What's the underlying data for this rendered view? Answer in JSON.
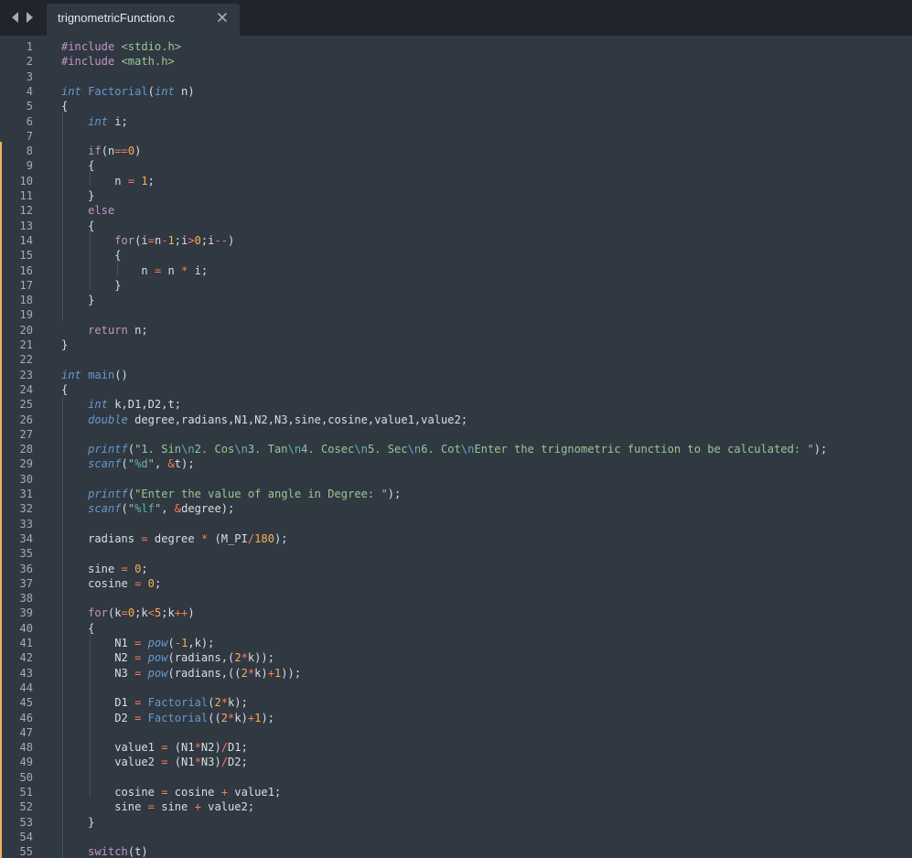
{
  "nav": {
    "back_icon": "chevron-left-icon",
    "forward_icon": "chevron-right-icon"
  },
  "tab": {
    "title": "trignometricFunction.c",
    "close_glyph": "×"
  },
  "colors": {
    "background": "#303841",
    "tabbar": "#1f252b",
    "keyword": "#c594c5",
    "type": "#6699cc",
    "function": "#6699cc",
    "operator": "#f97b58",
    "number": "#f9ae58",
    "string": "#99c794",
    "escape": "#5fb3b3",
    "plain": "#d8dee9",
    "line_number": "#a6acb3"
  },
  "code": {
    "lines": [
      [
        [
          "pp",
          "#include "
        ],
        [
          "ic",
          "<stdio.h>"
        ]
      ],
      [
        [
          "pp",
          "#include "
        ],
        [
          "ic",
          "<math.h>"
        ]
      ],
      [],
      [
        [
          "ty",
          "int"
        ],
        [
          "t",
          " "
        ],
        [
          "fn",
          "Factorial"
        ],
        [
          "t",
          "("
        ],
        [
          "ty",
          "int"
        ],
        [
          "t",
          " n)"
        ]
      ],
      [
        [
          "t",
          "{"
        ]
      ],
      [
        [
          "t",
          "    "
        ],
        [
          "ty",
          "int"
        ],
        [
          "t",
          " i;"
        ]
      ],
      [],
      [
        [
          "t",
          "    "
        ],
        [
          "kw",
          "if"
        ],
        [
          "t",
          "(n"
        ],
        [
          "op",
          "=="
        ],
        [
          "nm",
          "0"
        ],
        [
          "t",
          ")"
        ]
      ],
      [
        [
          "t",
          "    {"
        ]
      ],
      [
        [
          "t",
          "        n "
        ],
        [
          "op",
          "="
        ],
        [
          "t",
          " "
        ],
        [
          "nm",
          "1"
        ],
        [
          "t",
          ";"
        ]
      ],
      [
        [
          "t",
          "    }"
        ]
      ],
      [
        [
          "t",
          "    "
        ],
        [
          "kw",
          "else"
        ]
      ],
      [
        [
          "t",
          "    {"
        ]
      ],
      [
        [
          "t",
          "        "
        ],
        [
          "kw",
          "for"
        ],
        [
          "t",
          "(i"
        ],
        [
          "op",
          "="
        ],
        [
          "t",
          "n"
        ],
        [
          "op",
          "-"
        ],
        [
          "nm",
          "1"
        ],
        [
          "t",
          ";i"
        ],
        [
          "op",
          ">"
        ],
        [
          "nm",
          "0"
        ],
        [
          "t",
          ";i"
        ],
        [
          "op",
          "--"
        ],
        [
          "t",
          ")"
        ]
      ],
      [
        [
          "t",
          "        {"
        ]
      ],
      [
        [
          "t",
          "            n "
        ],
        [
          "op",
          "="
        ],
        [
          "t",
          " n "
        ],
        [
          "op",
          "*"
        ],
        [
          "t",
          " i;"
        ]
      ],
      [
        [
          "t",
          "        }"
        ]
      ],
      [
        [
          "t",
          "    }"
        ]
      ],
      [],
      [
        [
          "t",
          "    "
        ],
        [
          "kw",
          "return"
        ],
        [
          "t",
          " n;"
        ]
      ],
      [
        [
          "t",
          "}"
        ]
      ],
      [],
      [
        [
          "ty",
          "int"
        ],
        [
          "t",
          " "
        ],
        [
          "fn",
          "main"
        ],
        [
          "t",
          "()"
        ]
      ],
      [
        [
          "t",
          "{"
        ]
      ],
      [
        [
          "t",
          "    "
        ],
        [
          "ty",
          "int"
        ],
        [
          "t",
          " k,D1,D2,t;"
        ]
      ],
      [
        [
          "t",
          "    "
        ],
        [
          "ty",
          "double"
        ],
        [
          "t",
          " degree,radians,N1,N2,N3,sine,cosine,value1,value2;"
        ]
      ],
      [],
      [
        [
          "t",
          "    "
        ],
        [
          "ty",
          "printf"
        ],
        [
          "t",
          "("
        ],
        [
          "st",
          "\"1. Sin"
        ],
        [
          "es",
          "\\n"
        ],
        [
          "st",
          "2. Cos"
        ],
        [
          "es",
          "\\n"
        ],
        [
          "st",
          "3. Tan"
        ],
        [
          "es",
          "\\n"
        ],
        [
          "st",
          "4. Cosec"
        ],
        [
          "es",
          "\\n"
        ],
        [
          "st",
          "5. Sec"
        ],
        [
          "es",
          "\\n"
        ],
        [
          "st",
          "6. Cot"
        ],
        [
          "es",
          "\\n"
        ],
        [
          "st",
          "Enter the trignometric function to be calculated: \""
        ],
        [
          "t",
          ");"
        ]
      ],
      [
        [
          "t",
          "    "
        ],
        [
          "ty",
          "scanf"
        ],
        [
          "t",
          "("
        ],
        [
          "st",
          "\""
        ],
        [
          "es",
          "%d"
        ],
        [
          "st",
          "\""
        ],
        [
          "t",
          ", "
        ],
        [
          "op",
          "&"
        ],
        [
          "t",
          "t);"
        ]
      ],
      [],
      [
        [
          "t",
          "    "
        ],
        [
          "ty",
          "printf"
        ],
        [
          "t",
          "("
        ],
        [
          "st",
          "\"Enter the value of angle in Degree: \""
        ],
        [
          "t",
          ");"
        ]
      ],
      [
        [
          "t",
          "    "
        ],
        [
          "ty",
          "scanf"
        ],
        [
          "t",
          "("
        ],
        [
          "st",
          "\""
        ],
        [
          "es",
          "%lf"
        ],
        [
          "st",
          "\""
        ],
        [
          "t",
          ", "
        ],
        [
          "op",
          "&"
        ],
        [
          "t",
          "degree);"
        ]
      ],
      [],
      [
        [
          "t",
          "    radians "
        ],
        [
          "op",
          "="
        ],
        [
          "t",
          " degree "
        ],
        [
          "op",
          "*"
        ],
        [
          "t",
          " (M_PI"
        ],
        [
          "op",
          "/"
        ],
        [
          "nm",
          "180"
        ],
        [
          "t",
          ");"
        ]
      ],
      [],
      [
        [
          "t",
          "    sine "
        ],
        [
          "op",
          "="
        ],
        [
          "t",
          " "
        ],
        [
          "nm",
          "0"
        ],
        [
          "t",
          ";"
        ]
      ],
      [
        [
          "t",
          "    cosine "
        ],
        [
          "op",
          "="
        ],
        [
          "t",
          " "
        ],
        [
          "nm",
          "0"
        ],
        [
          "t",
          ";"
        ]
      ],
      [],
      [
        [
          "t",
          "    "
        ],
        [
          "kw",
          "for"
        ],
        [
          "t",
          "(k"
        ],
        [
          "op",
          "="
        ],
        [
          "nm",
          "0"
        ],
        [
          "t",
          ";k"
        ],
        [
          "op",
          "<"
        ],
        [
          "nm",
          "5"
        ],
        [
          "t",
          ";k"
        ],
        [
          "op",
          "++"
        ],
        [
          "t",
          ")"
        ]
      ],
      [
        [
          "t",
          "    {"
        ]
      ],
      [
        [
          "t",
          "        N1 "
        ],
        [
          "op",
          "="
        ],
        [
          "t",
          " "
        ],
        [
          "ty",
          "pow"
        ],
        [
          "t",
          "("
        ],
        [
          "op",
          "-"
        ],
        [
          "nm",
          "1"
        ],
        [
          "t",
          ",k);"
        ]
      ],
      [
        [
          "t",
          "        N2 "
        ],
        [
          "op",
          "="
        ],
        [
          "t",
          " "
        ],
        [
          "ty",
          "pow"
        ],
        [
          "t",
          "(radians,("
        ],
        [
          "nm",
          "2"
        ],
        [
          "op",
          "*"
        ],
        [
          "t",
          "k));"
        ]
      ],
      [
        [
          "t",
          "        N3 "
        ],
        [
          "op",
          "="
        ],
        [
          "t",
          " "
        ],
        [
          "ty",
          "pow"
        ],
        [
          "t",
          "(radians,(("
        ],
        [
          "nm",
          "2"
        ],
        [
          "op",
          "*"
        ],
        [
          "t",
          "k)"
        ],
        [
          "op",
          "+"
        ],
        [
          "nm",
          "1"
        ],
        [
          "t",
          "));"
        ]
      ],
      [],
      [
        [
          "t",
          "        D1 "
        ],
        [
          "op",
          "="
        ],
        [
          "t",
          " "
        ],
        [
          "fn",
          "Factorial"
        ],
        [
          "t",
          "("
        ],
        [
          "nm",
          "2"
        ],
        [
          "op",
          "*"
        ],
        [
          "t",
          "k);"
        ]
      ],
      [
        [
          "t",
          "        D2 "
        ],
        [
          "op",
          "="
        ],
        [
          "t",
          " "
        ],
        [
          "fn",
          "Factorial"
        ],
        [
          "t",
          "(("
        ],
        [
          "nm",
          "2"
        ],
        [
          "op",
          "*"
        ],
        [
          "t",
          "k)"
        ],
        [
          "op",
          "+"
        ],
        [
          "nm",
          "1"
        ],
        [
          "t",
          ");"
        ]
      ],
      [],
      [
        [
          "t",
          "        value1 "
        ],
        [
          "op",
          "="
        ],
        [
          "t",
          " (N1"
        ],
        [
          "op",
          "*"
        ],
        [
          "t",
          "N2)"
        ],
        [
          "op",
          "/"
        ],
        [
          "t",
          "D1;"
        ]
      ],
      [
        [
          "t",
          "        value2 "
        ],
        [
          "op",
          "="
        ],
        [
          "t",
          " (N1"
        ],
        [
          "op",
          "*"
        ],
        [
          "t",
          "N3)"
        ],
        [
          "op",
          "/"
        ],
        [
          "t",
          "D2;"
        ]
      ],
      [],
      [
        [
          "t",
          "        cosine "
        ],
        [
          "op",
          "="
        ],
        [
          "t",
          " cosine "
        ],
        [
          "op",
          "+"
        ],
        [
          "t",
          " value1;"
        ]
      ],
      [
        [
          "t",
          "        sine "
        ],
        [
          "op",
          "="
        ],
        [
          "t",
          " sine "
        ],
        [
          "op",
          "+"
        ],
        [
          "t",
          " value2;"
        ]
      ],
      [
        [
          "t",
          "    }"
        ]
      ],
      [],
      [
        [
          "t",
          "    "
        ],
        [
          "kw",
          "switch"
        ],
        [
          "t",
          "(t)"
        ]
      ]
    ]
  }
}
